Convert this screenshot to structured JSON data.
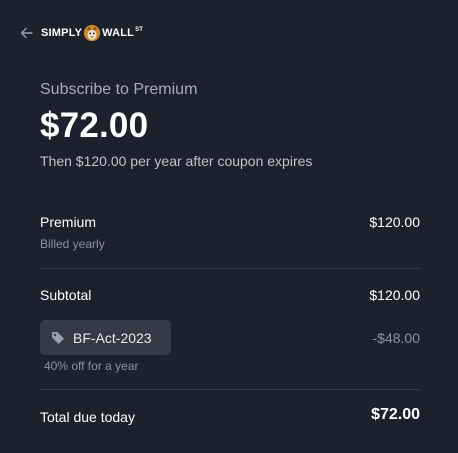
{
  "header": {
    "logo_text_left": "SIMPLY",
    "logo_text_right": "WALL",
    "logo_text_sup": "ST"
  },
  "summary": {
    "subscribe_label": "Subscribe to Premium",
    "price": "$72.00",
    "after_coupon": "Then $120.00 per year after coupon expires"
  },
  "lines": {
    "premium_label": "Premium",
    "premium_billing": "Billed yearly",
    "premium_amount": "$120.00",
    "subtotal_label": "Subtotal",
    "subtotal_amount": "$120.00"
  },
  "coupon": {
    "code": "BF-Act-2023",
    "note": "40% off for a year",
    "discount": "-$48.00"
  },
  "total": {
    "label": "Total due today",
    "amount": "$72.00"
  },
  "colors": {
    "background": "#1b212d",
    "coupon_chip": "#343a46",
    "divider": "#343b48"
  },
  "icons": [
    "back-arrow-icon",
    "logo-mascot-icon",
    "tag-icon"
  ]
}
